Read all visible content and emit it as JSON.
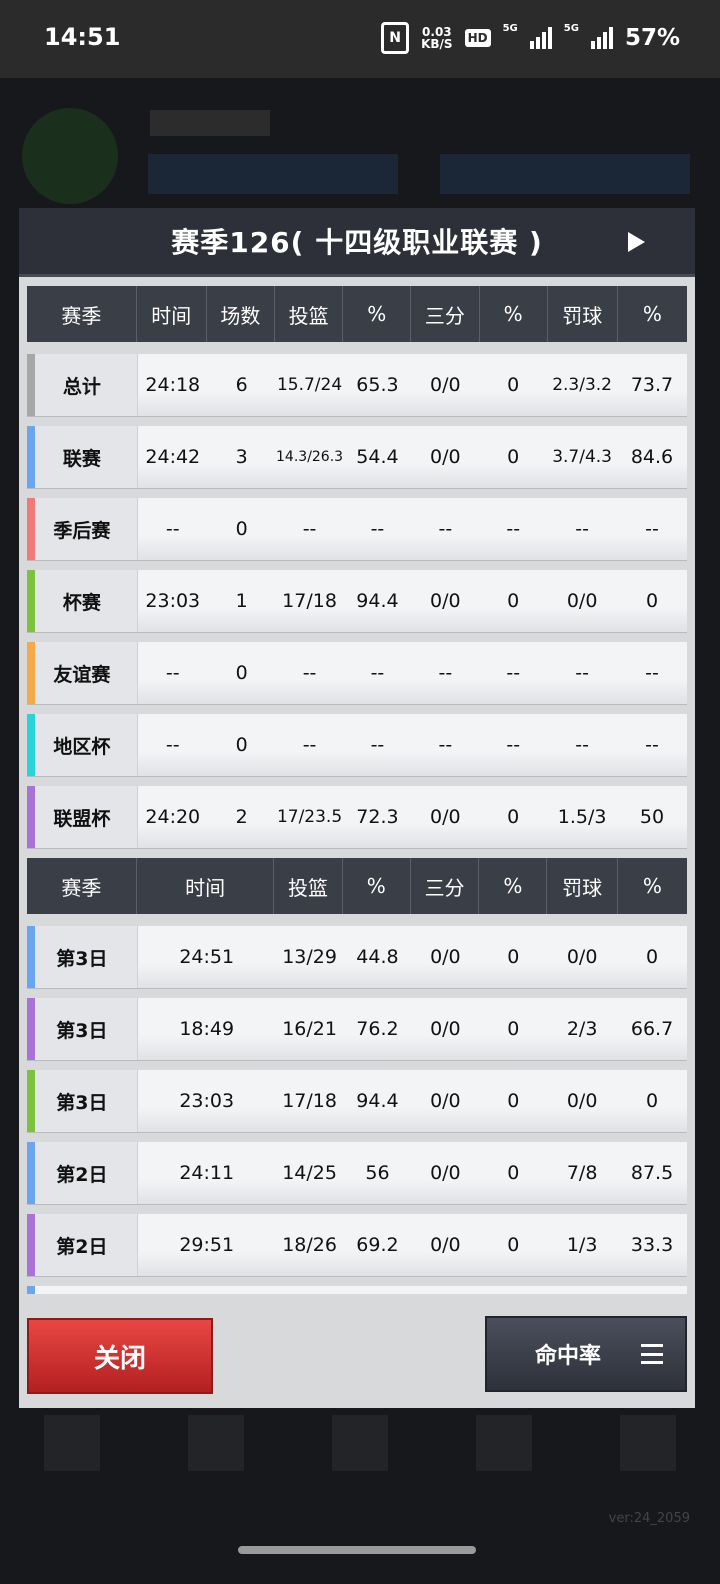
{
  "status": {
    "time": "14:51",
    "net_speed": "0.03",
    "net_unit": "KB/S",
    "hd": "HD",
    "sim1": "5G",
    "sim2": "5G",
    "battery": "57%"
  },
  "background": {
    "version": "ver:24_2059"
  },
  "modal": {
    "title": "赛季126( 十四级职业联赛 )",
    "summary_table": {
      "headers": [
        "赛季",
        "时间",
        "场数",
        "投篮",
        "%",
        "三分",
        "%",
        "罚球",
        "%"
      ],
      "rows": [
        {
          "label": "总计",
          "color": "#a7a7a7",
          "cells": [
            "24:18",
            "6",
            "15.7/24",
            "65.3",
            "0/0",
            "0",
            "2.3/3.2",
            "73.7"
          ]
        },
        {
          "label": "联赛",
          "color": "#6aa6f0",
          "cells": [
            "24:42",
            "3",
            "14.3/26.3",
            "54.4",
            "0/0",
            "0",
            "3.7/4.3",
            "84.6"
          ]
        },
        {
          "label": "季后赛",
          "color": "#f07a7a",
          "cells": [
            "--",
            "0",
            "--",
            "--",
            "--",
            "--",
            "--",
            "--"
          ]
        },
        {
          "label": "杯赛",
          "color": "#7cc23f",
          "cells": [
            "23:03",
            "1",
            "17/18",
            "94.4",
            "0/0",
            "0",
            "0/0",
            "0"
          ]
        },
        {
          "label": "友谊赛",
          "color": "#f5a948",
          "cells": [
            "--",
            "0",
            "--",
            "--",
            "--",
            "--",
            "--",
            "--"
          ]
        },
        {
          "label": "地区杯",
          "color": "#2ad3d8",
          "cells": [
            "--",
            "0",
            "--",
            "--",
            "--",
            "--",
            "--",
            "--"
          ]
        },
        {
          "label": "联盟杯",
          "color": "#a872d6",
          "cells": [
            "24:20",
            "2",
            "17/23.5",
            "72.3",
            "0/0",
            "0",
            "1.5/3",
            "50"
          ]
        }
      ]
    },
    "game_table": {
      "headers": [
        "赛季",
        "时间",
        "投篮",
        "%",
        "三分",
        "%",
        "罚球",
        "%"
      ],
      "rows": [
        {
          "label": "第3日",
          "color": "#6aa6f0",
          "cells": [
            "24:51",
            "13/29",
            "44.8",
            "0/0",
            "0",
            "0/0",
            "0"
          ]
        },
        {
          "label": "第3日",
          "color": "#a872d6",
          "cells": [
            "18:49",
            "16/21",
            "76.2",
            "0/0",
            "0",
            "2/3",
            "66.7"
          ]
        },
        {
          "label": "第3日",
          "color": "#7cc23f",
          "cells": [
            "23:03",
            "17/18",
            "94.4",
            "0/0",
            "0",
            "0/0",
            "0"
          ]
        },
        {
          "label": "第2日",
          "color": "#6aa6f0",
          "cells": [
            "24:11",
            "14/25",
            "56",
            "0/0",
            "0",
            "7/8",
            "87.5"
          ]
        },
        {
          "label": "第2日",
          "color": "#a872d6",
          "cells": [
            "29:51",
            "18/26",
            "69.2",
            "0/0",
            "0",
            "1/3",
            "33.3"
          ]
        }
      ]
    },
    "close_label": "关闭",
    "sort_label": "命中率"
  }
}
